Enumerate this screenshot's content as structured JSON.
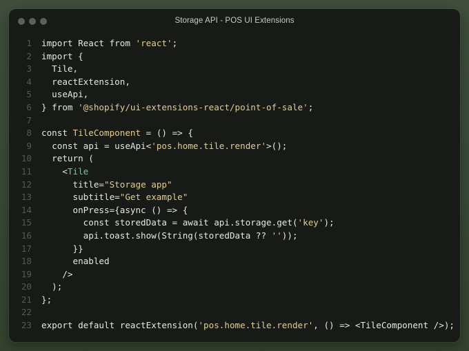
{
  "window": {
    "title": "Storage API - POS UI Extensions",
    "colors": {
      "background": "#3e4e3b",
      "editor": "#171a17",
      "text": "#e6e8e3",
      "string": "#e3cf87",
      "tag": "#7fc39b",
      "line_number": "#555a55"
    }
  },
  "editor": {
    "lines": [
      {
        "n": "1",
        "tokens": [
          {
            "t": "import React from ",
            "c": "plain"
          },
          {
            "t": "'react'",
            "c": "str"
          },
          {
            "t": ";",
            "c": "plain"
          }
        ]
      },
      {
        "n": "2",
        "tokens": [
          {
            "t": "import {",
            "c": "plain"
          }
        ]
      },
      {
        "n": "3",
        "tokens": [
          {
            "t": "  Tile,",
            "c": "plain"
          }
        ]
      },
      {
        "n": "4",
        "tokens": [
          {
            "t": "  reactExtension,",
            "c": "plain"
          }
        ]
      },
      {
        "n": "5",
        "tokens": [
          {
            "t": "  useApi,",
            "c": "plain"
          }
        ]
      },
      {
        "n": "6",
        "tokens": [
          {
            "t": "} from ",
            "c": "plain"
          },
          {
            "t": "'@shopify/ui-extensions-react/point-of-sale'",
            "c": "str"
          },
          {
            "t": ";",
            "c": "plain"
          }
        ]
      },
      {
        "n": "7",
        "tokens": []
      },
      {
        "n": "8",
        "tokens": [
          {
            "t": "const ",
            "c": "plain"
          },
          {
            "t": "TileComponent",
            "c": "str"
          },
          {
            "t": " = () => {",
            "c": "plain"
          }
        ]
      },
      {
        "n": "9",
        "tokens": [
          {
            "t": "  const api = useApi<",
            "c": "plain"
          },
          {
            "t": "'pos.home.tile.render'",
            "c": "str"
          },
          {
            "t": ">();",
            "c": "plain"
          }
        ]
      },
      {
        "n": "10",
        "tokens": [
          {
            "t": "  return (",
            "c": "plain"
          }
        ]
      },
      {
        "n": "11",
        "tokens": [
          {
            "t": "    <",
            "c": "plain"
          },
          {
            "t": "Tile",
            "c": "tag"
          }
        ]
      },
      {
        "n": "12",
        "tokens": [
          {
            "t": "      title=",
            "c": "plain"
          },
          {
            "t": "\"Storage app\"",
            "c": "str"
          }
        ]
      },
      {
        "n": "13",
        "tokens": [
          {
            "t": "      subtitle=",
            "c": "plain"
          },
          {
            "t": "\"Get example\"",
            "c": "str"
          }
        ]
      },
      {
        "n": "14",
        "tokens": [
          {
            "t": "      onPress={async () => {",
            "c": "plain"
          }
        ]
      },
      {
        "n": "15",
        "tokens": [
          {
            "t": "        const storedData = await api.storage.get(",
            "c": "plain"
          },
          {
            "t": "'key'",
            "c": "str"
          },
          {
            "t": ");",
            "c": "plain"
          }
        ]
      },
      {
        "n": "16",
        "tokens": [
          {
            "t": "        api.toast.show(String(storedData ?? ",
            "c": "plain"
          },
          {
            "t": "''",
            "c": "str"
          },
          {
            "t": "));",
            "c": "plain"
          }
        ]
      },
      {
        "n": "17",
        "tokens": [
          {
            "t": "      }}",
            "c": "plain"
          }
        ]
      },
      {
        "n": "18",
        "tokens": [
          {
            "t": "      enabled",
            "c": "plain"
          }
        ]
      },
      {
        "n": "19",
        "tokens": [
          {
            "t": "    />",
            "c": "plain"
          }
        ]
      },
      {
        "n": "20",
        "tokens": [
          {
            "t": "  );",
            "c": "plain"
          }
        ]
      },
      {
        "n": "21",
        "tokens": [
          {
            "t": "};",
            "c": "plain"
          }
        ]
      },
      {
        "n": "22",
        "tokens": []
      },
      {
        "n": "23",
        "tokens": [
          {
            "t": "export default reactExtension(",
            "c": "plain"
          },
          {
            "t": "'pos.home.tile.render'",
            "c": "str"
          },
          {
            "t": ", () => <TileComponent />);",
            "c": "plain"
          }
        ]
      }
    ]
  }
}
